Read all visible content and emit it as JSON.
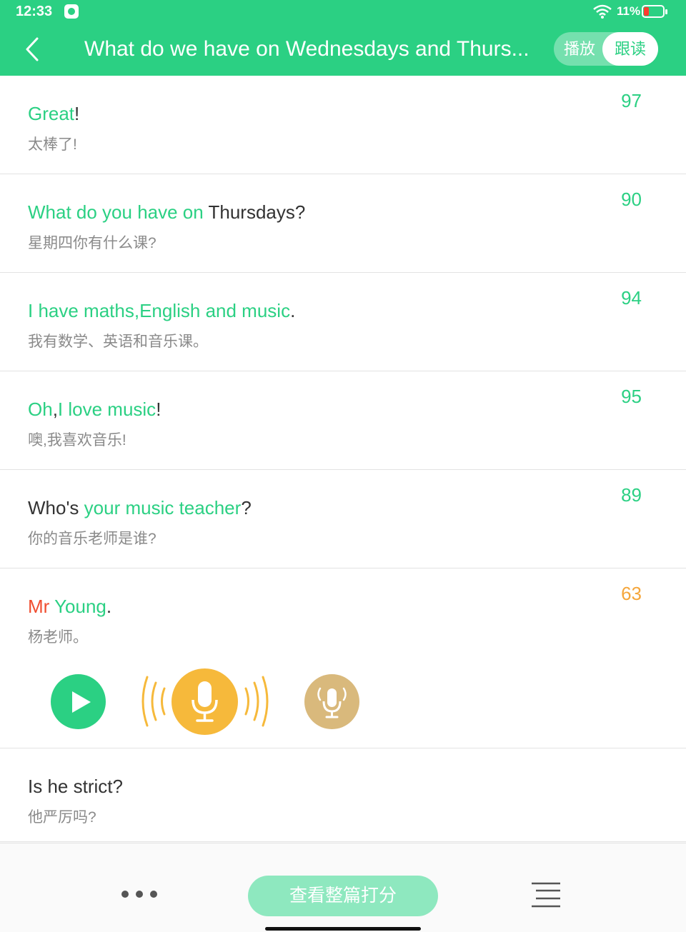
{
  "status_bar": {
    "time": "12:33",
    "battery": "11%"
  },
  "header": {
    "title": "What do we have on Wednesdays and Thurs...",
    "mode_play": "播放",
    "mode_follow": "跟读"
  },
  "sentences": [
    {
      "en": [
        {
          "t": "Great",
          "c": "g"
        },
        {
          "t": "!",
          "c": "d"
        }
      ],
      "cn": "太棒了!",
      "score": "97"
    },
    {
      "en": [
        {
          "t": "What do you have on ",
          "c": "g"
        },
        {
          "t": "Thursdays?",
          "c": "d"
        }
      ],
      "cn": "星期四你有什么课?",
      "score": "90"
    },
    {
      "en": [
        {
          "t": "I have maths,English and music",
          "c": "g"
        },
        {
          "t": ".",
          "c": "d"
        }
      ],
      "cn": "我有数学、英语和音乐课。",
      "score": "94"
    },
    {
      "en": [
        {
          "t": "Oh",
          "c": "g"
        },
        {
          "t": ",",
          "c": "d"
        },
        {
          "t": "I love music",
          "c": "g"
        },
        {
          "t": "!",
          "c": "d"
        }
      ],
      "cn": "噢,我喜欢音乐!",
      "score": "95"
    },
    {
      "en": [
        {
          "t": "Who's ",
          "c": "d"
        },
        {
          "t": "your music teacher",
          "c": "g"
        },
        {
          "t": "?",
          "c": "d"
        }
      ],
      "cn": "你的音乐老师是谁?",
      "score": "89"
    },
    {
      "en": [
        {
          "t": "Mr ",
          "c": "r"
        },
        {
          "t": "Young",
          "c": "g"
        },
        {
          "t": ".",
          "c": "d"
        }
      ],
      "cn": "杨老师。",
      "score": "63",
      "active": true
    },
    {
      "en": [
        {
          "t": "Is he strict?",
          "c": "d"
        }
      ],
      "cn": "他严厉吗?",
      "score": ""
    }
  ],
  "footer": {
    "score_all_label": "查看整篇打分"
  },
  "colors": {
    "accent": "#2bd083",
    "record": "#f6b93b",
    "replay": "#d9b97c",
    "low_score": "#f5a63b",
    "error": "#f04e30"
  },
  "icons": [
    "back-arrow-icon",
    "wifi-icon",
    "battery-icon",
    "play-icon",
    "microphone-icon",
    "replay-recording-icon",
    "more-dots-icon",
    "list-menu-icon"
  ]
}
